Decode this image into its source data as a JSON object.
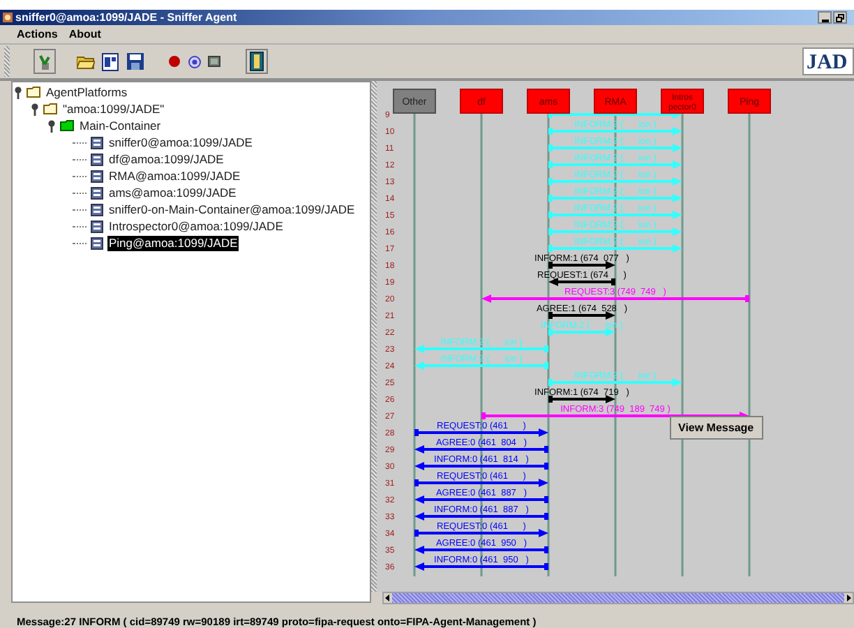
{
  "window": {
    "title": "sniffer0@amoa:1099/JADE - Sniffer Agent"
  },
  "menu": [
    "Actions",
    "About"
  ],
  "toolbar": {
    "logo": "JAD"
  },
  "tree": [
    {
      "label": "AgentPlatforms",
      "kind": "folder",
      "expanded": true,
      "selected": false,
      "children": [
        {
          "label": "\"amoa:1099/JADE\"",
          "kind": "folder",
          "expanded": true,
          "selected": false,
          "children": [
            {
              "label": "Main-Container",
              "kind": "container",
              "expanded": true,
              "selected": false,
              "children": [
                {
                  "label": "sniffer0@amoa:1099/JADE",
                  "kind": "agent",
                  "selected": false
                },
                {
                  "label": "df@amoa:1099/JADE",
                  "kind": "agent",
                  "selected": false
                },
                {
                  "label": "RMA@amoa:1099/JADE",
                  "kind": "agent",
                  "selected": false
                },
                {
                  "label": "ams@amoa:1099/JADE",
                  "kind": "agent",
                  "selected": false
                },
                {
                  "label": "sniffer0-on-Main-Container@amoa:1099/JADE",
                  "kind": "agent",
                  "selected": false
                },
                {
                  "label": "Introspector0@amoa:1099/JADE",
                  "kind": "agent",
                  "selected": false
                },
                {
                  "label": "Ping@amoa:1099/JADE",
                  "kind": "agent",
                  "selected": true
                }
              ]
            }
          ]
        }
      ]
    }
  ],
  "agents": [
    {
      "lines": [
        "Other"
      ],
      "kind": "other"
    },
    {
      "lines": [
        "df"
      ],
      "kind": "sniffed"
    },
    {
      "lines": [
        "ams"
      ],
      "kind": "sniffed"
    },
    {
      "lines": [
        "RMA"
      ],
      "kind": "sniffed"
    },
    {
      "lines": [
        "Intros",
        "pector0"
      ],
      "kind": "sniffed"
    },
    {
      "lines": [
        "Ping"
      ],
      "kind": "sniffed"
    }
  ],
  "messages": [
    {
      "row": "9",
      "kind": "ams_introspector",
      "color": "#33ffff"
    },
    {
      "row": "10",
      "kind": "ams_introspector",
      "color": "#33ffff",
      "label": "INFORM:2 (      ion )"
    },
    {
      "row": "11",
      "kind": "ams_introspector",
      "color": "#33ffff",
      "label": "INFORM:2 (      ion )"
    },
    {
      "row": "12",
      "kind": "ams_introspector",
      "color": "#33ffff",
      "label": "INFORM:2 (      ion )"
    },
    {
      "row": "13",
      "kind": "ams_introspector",
      "color": "#33ffff",
      "label": "INFORM:2 (      ion )"
    },
    {
      "row": "14",
      "kind": "ams_introspector",
      "color": "#33ffff",
      "label": "INFORM:2 (      ion )"
    },
    {
      "row": "15",
      "kind": "ams_introspector",
      "color": "#33ffff",
      "label": "INFORM:2 (      ion )"
    },
    {
      "row": "16",
      "kind": "ams_introspector",
      "color": "#33ffff",
      "label": "INFORM:2 (      ion )"
    },
    {
      "row": "17",
      "kind": "ams_introspector",
      "color": "#33ffff",
      "label": "INFORM:2 (      ion )"
    },
    {
      "row": "18",
      "kind": "ams_rma",
      "color": "#000000",
      "label": "INFORM:1 (674  077   )"
    },
    {
      "row": "19",
      "kind": "rma_ams",
      "color": "#000000",
      "label": "REQUEST:1 (674      )"
    },
    {
      "row": "20",
      "kind": "ping_df",
      "color": "#ff00ff",
      "label": "REQUEST:3 (749  749   )"
    },
    {
      "row": "21",
      "kind": "ams_rma",
      "color": "#000000",
      "label": "AGREE:1 (674  528   )"
    },
    {
      "row": "22",
      "kind": "ams_rma",
      "color": "#33ffff",
      "label": "INFORM:2 (      ion )"
    },
    {
      "row": "23",
      "kind": "ams_other",
      "color": "#33ffff",
      "label": "INFORM:2 (      ion )"
    },
    {
      "row": "24",
      "kind": "ams_other",
      "color": "#33ffff",
      "label": "INFORM:2 (      ion )"
    },
    {
      "row": "25",
      "kind": "ams_introspector",
      "color": "#33ffff",
      "label": "INFORM:2 (      ion )"
    },
    {
      "row": "26",
      "kind": "ams_rma",
      "color": "#000000",
      "label": "INFORM:1 (674  719   )"
    },
    {
      "row": "27",
      "kind": "df_ping",
      "color": "#ff00ff",
      "label": "INFORM:3 (749  189  749 )"
    },
    {
      "row": "28",
      "kind": "other_ams",
      "color": "#0000ff",
      "label": "REQUEST:0 (461      )"
    },
    {
      "row": "29",
      "kind": "ams_other",
      "color": "#0000ff",
      "label": "AGREE:0 (461  804   )"
    },
    {
      "row": "30",
      "kind": "ams_other",
      "color": "#0000ff",
      "label": "INFORM:0 (461  814   )"
    },
    {
      "row": "31",
      "kind": "other_ams",
      "color": "#0000ff",
      "label": "REQUEST:0 (461      )"
    },
    {
      "row": "32",
      "kind": "ams_other",
      "color": "#0000ff",
      "label": "AGREE:0 (461  887   )"
    },
    {
      "row": "33",
      "kind": "ams_other",
      "color": "#0000ff",
      "label": "INFORM:0 (461  887   )"
    },
    {
      "row": "34",
      "kind": "other_ams",
      "color": "#0000ff",
      "label": "REQUEST:0 (461      )"
    },
    {
      "row": "35",
      "kind": "ams_other",
      "color": "#0000ff",
      "label": "AGREE:0 (461  950   )"
    },
    {
      "row": "36",
      "kind": "ams_other",
      "color": "#0000ff",
      "label": "INFORM:0 (461  950   )"
    }
  ],
  "context_menu": {
    "items": [
      "View Message"
    ]
  },
  "status_bar": "Message:27 INFORM ( cid=89749 rw=90189 irt=89749 proto=fipa-request onto=FIPA-Agent-Management )"
}
